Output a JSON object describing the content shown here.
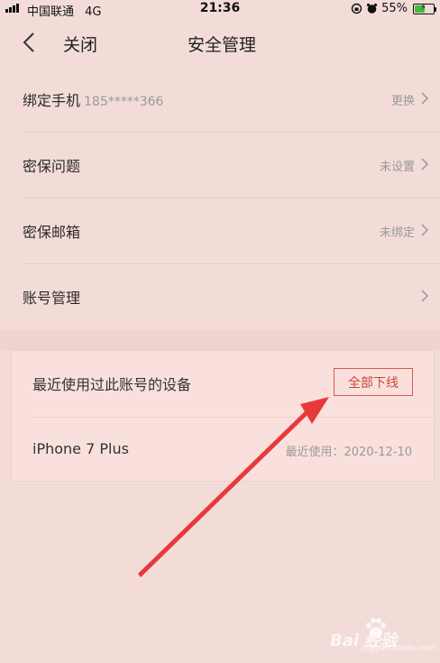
{
  "status_bar": {
    "carrier": "中国联通",
    "network": "4G",
    "time": "21:36",
    "battery_percent": "55%",
    "battery_level": 0.55
  },
  "nav": {
    "close_label": "关闭",
    "title": "安全管理"
  },
  "settings": [
    {
      "label": "绑定手机",
      "sub": "185*****366",
      "value": "更换"
    },
    {
      "label": "密保问题",
      "sub": "",
      "value": "未设置"
    },
    {
      "label": "密保邮箱",
      "sub": "",
      "value": "未绑定"
    },
    {
      "label": "账号管理",
      "sub": "",
      "value": ""
    }
  ],
  "devices": {
    "title": "最近使用过此账号的设备",
    "logout_all_label": "全部下线",
    "items": [
      {
        "name": "iPhone 7 Plus",
        "last_used": "最近使用：2020-12-10"
      }
    ]
  },
  "annotation": {
    "arrow_color": "#e8393a"
  },
  "watermark": {
    "text": "Bai 经验",
    "sub": "jingyan.baidu.com"
  }
}
